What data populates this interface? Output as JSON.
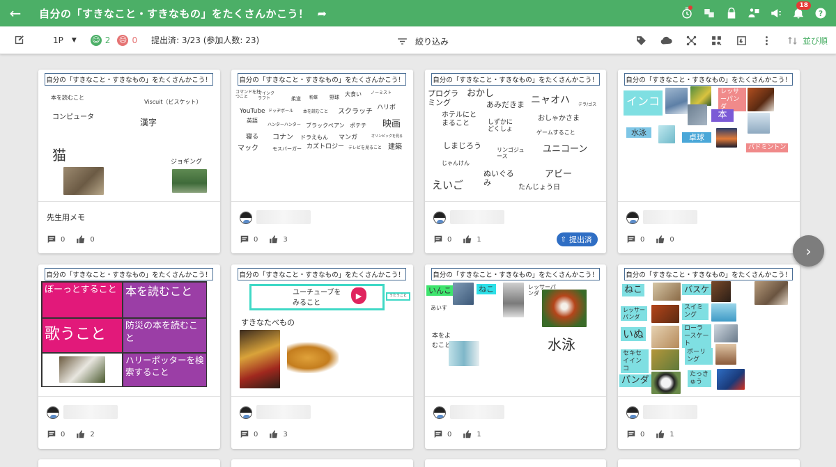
{
  "header": {
    "title": "自分の「すきなこと・すきなもの」をたくさんかこう！",
    "notification_count": "18",
    "accent_color": "#4caf67"
  },
  "toolbar": {
    "page": "1P",
    "good_count": "2",
    "bad_count": "0",
    "submitted_text": "提出済: 3/23 (参加人数: 23)",
    "filter_label": "絞り込み",
    "sort_label": "並び順"
  },
  "card_heading": "自分の「すきなこと・すきなもの」をたくさんかこう！",
  "cards": [
    {
      "bottom_label": "先生用メモ",
      "comments": "0",
      "likes": "0",
      "words": {
        "w1": "本を読むこと",
        "w2": "Viscuit（ビスケット）",
        "w3": "コンピュータ",
        "w4": "漢字",
        "w5": "猫",
        "w6": "ジョギング"
      }
    },
    {
      "comments": "0",
      "likes": "3",
      "words": {
        "w1": "コマンドを打つこと",
        "w2": "マインクラフト",
        "w3": "柔道",
        "w4": "粉蝶",
        "w5": "野球",
        "w6": "大食い",
        "w7": "ノーミスト",
        "w8": "YouTube",
        "w9": "ドッヂボール",
        "w10": "本を読むこと",
        "w11": "スクラッチ",
        "w12": "ハリポ",
        "w13": "英語",
        "w14": "ハンターハンター",
        "w15": "ブラックペアン",
        "w16": "ポテチ",
        "w17": "映画",
        "w18": "寝る",
        "w19": "コナン",
        "w20": "ドラえもん",
        "w21": "マンガ",
        "w22": "オリンピックを見る",
        "w23": "マック",
        "w24": "モスバーガー",
        "w25": "カズトロジー",
        "w26": "テレビを見ること",
        "w27": "建築"
      }
    },
    {
      "comments": "0",
      "likes": "1",
      "status": "提出済",
      "words": {
        "w1": "プログラミング",
        "w2": "おかし",
        "w3": "あみだきま",
        "w4": "ニャオハ",
        "w5": "テラ/ゴス",
        "w6": "ホテルにとまること",
        "w7": "しずかにどくしょ",
        "w8": "おしゃかさま",
        "w9": "ゲームすること",
        "w10": "しまじろう",
        "w11": "リンゴジュース",
        "w12": "ユニコーン",
        "w13": "じゃんけん",
        "w14": "えいご",
        "w15": "ぬいぐるみ",
        "w16": "アビー",
        "w17": "たんじょう日"
      }
    },
    {
      "comments": "0",
      "likes": "0",
      "words": {
        "w1": "インコ",
        "w2": "レッサーパンダ",
        "w3": "本",
        "w4": "水泳",
        "w5": "卓球",
        "w6": "バドミントン"
      }
    },
    {
      "comments": "0",
      "likes": "2",
      "cells": {
        "c1": "ぼーっとすること",
        "c2": "本を読むこと",
        "c3": "歌うこと",
        "c4": "防災の本を読むこと",
        "c5": "ハリーポッターを検索すること"
      }
    },
    {
      "comments": "0",
      "likes": "3",
      "words": {
        "w1": "ユーチューブをみること",
        "w2": "うたうこと",
        "w3": "すきなたべもの"
      }
    },
    {
      "comments": "0",
      "likes": "1",
      "words": {
        "w1": "いんこ",
        "w2": "ねこ",
        "w3": "レッサーパンダ",
        "w4": "あいす",
        "w5": "本をよむこと",
        "w6": "水泳"
      }
    },
    {
      "comments": "0",
      "likes": "1",
      "words": {
        "w1": "ねこ",
        "w2": "バスケ",
        "w3": "レッサーパンダ",
        "w4": "スイミング",
        "w5": "いぬ",
        "w6": "ローラースケート",
        "w7": "セキセイインコ",
        "w8": "ボーリング",
        "w9": "パンダ",
        "w10": "たっきゅう"
      }
    }
  ]
}
